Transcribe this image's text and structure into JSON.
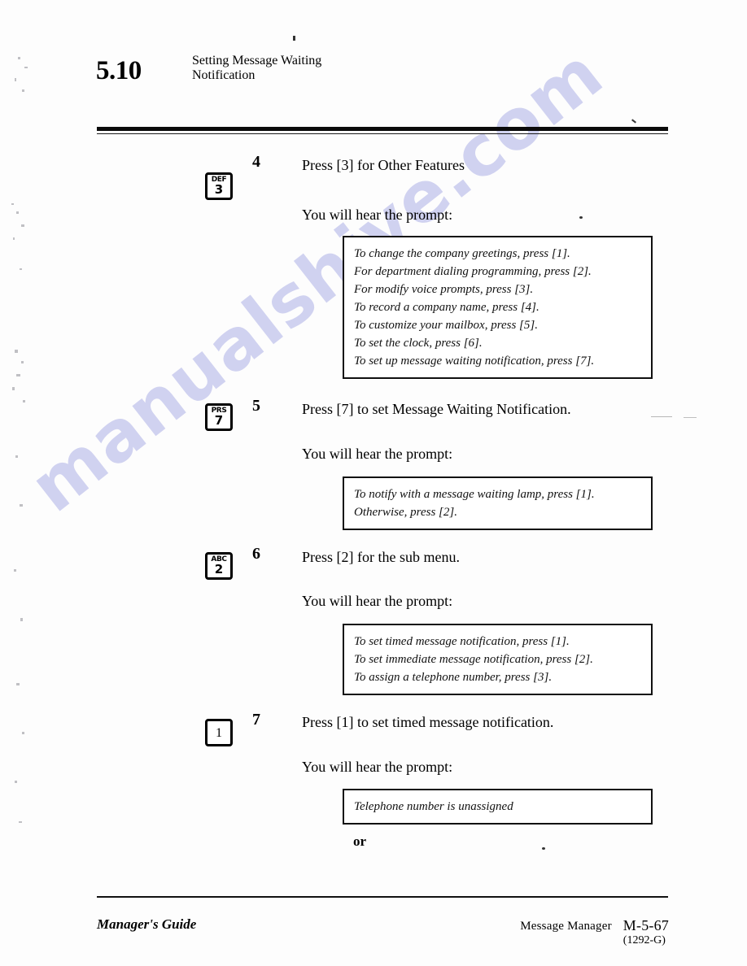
{
  "heading": {
    "number": "5.10",
    "title_line1": "Setting Message Waiting",
    "title_line2": "Notification"
  },
  "hear_prompt_label": "You will hear the prompt:",
  "or_label": "or",
  "watermark": "manualshive.com",
  "steps": [
    {
      "number": "4",
      "key": {
        "letters": "DEF",
        "digit": "3"
      },
      "instruction": "Press [3] for Other Features",
      "hear": "You will hear the prompt:",
      "prompt_lines": [
        "To change the company greetings, press [1].",
        "For department dialing programming, press [2].",
        "For modify voice prompts, press [3].",
        "To record a company name, press [4].",
        "To customize your mailbox, press [5].",
        "To set the clock, press [6].",
        "To set up message waiting notification, press [7]."
      ]
    },
    {
      "number": "5",
      "key": {
        "letters": "PRS",
        "digit": "7"
      },
      "instruction": "Press [7] to set Message Waiting Notification.",
      "hear": "You will hear the prompt:",
      "prompt_lines": [
        "To notify with a message waiting lamp, press [1].",
        "Otherwise, press [2]."
      ]
    },
    {
      "number": "6",
      "key": {
        "letters": "ABC",
        "digit": "2"
      },
      "instruction": "Press [2] for the sub menu.",
      "hear": "You will hear the prompt:",
      "prompt_lines": [
        "To set timed message notification, press [1].",
        "To set immediate message notification, press [2].",
        "To assign a telephone number, press [3]."
      ]
    },
    {
      "number": "7",
      "key": {
        "letters": "",
        "digit": "1"
      },
      "instruction": "Press [1] to set timed message notification.",
      "hear": "You will hear the prompt:",
      "prompt_lines": [
        "Telephone number is unassigned"
      ]
    }
  ],
  "footer": {
    "left": "Manager's Guide",
    "product": "Message Manager",
    "page_code": "M-5-67",
    "revision": "(1292-G)"
  }
}
